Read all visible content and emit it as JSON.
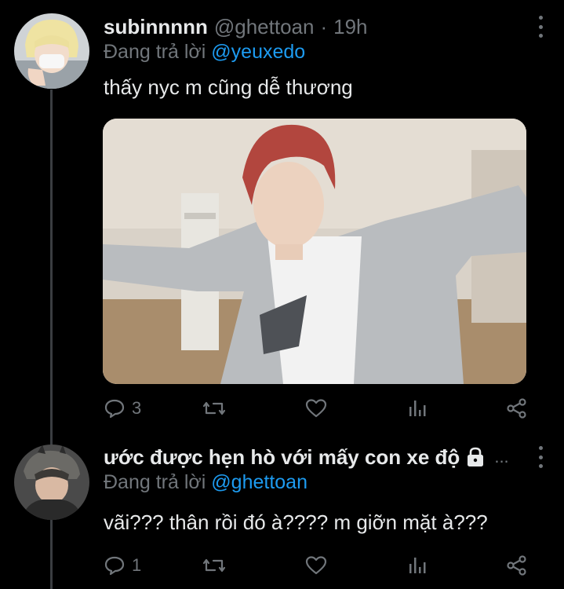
{
  "tweets": [
    {
      "display_name": "subinnnnn",
      "handle": "@ghettoan",
      "separator": "·",
      "time": "19h",
      "replying_prefix": "Đang trả lời ",
      "replying_to": "@yeuxedo",
      "text": "thấy nyc m cũng dễ thương",
      "has_media": true,
      "reply_count": "3"
    },
    {
      "display_name": "ước được hẹn hò với mấy con xe độ",
      "ellipsis": "...",
      "protected": true,
      "replying_prefix": "Đang trả lời ",
      "replying_to": "@ghettoan",
      "text": "vãi??? thân rồi đó à???? m giỡn mặt à???",
      "reply_count": "1"
    }
  ],
  "icons": {
    "reply": "reply-bubble-icon",
    "retweet": "retweet-icon",
    "like": "heart-icon",
    "views": "views-bar-chart-icon",
    "share": "share-icon",
    "more": "more-vertical-icon",
    "lock": "lock-icon"
  },
  "colors": {
    "background": "#000000",
    "text": "#e7e9ea",
    "secondary": "#71767b",
    "accent": "#1d9bf0",
    "thread_line": "#3a3d41"
  }
}
